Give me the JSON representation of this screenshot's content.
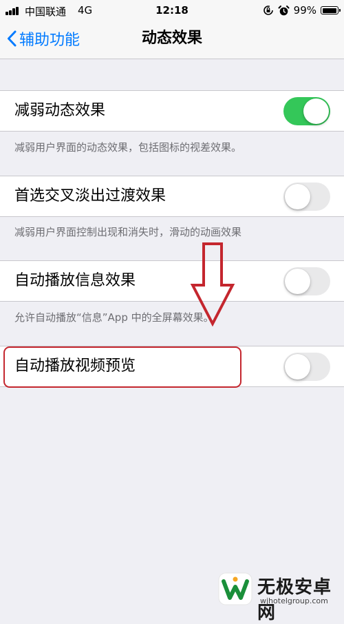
{
  "status_bar": {
    "carrier": "中国联通",
    "network": "4G",
    "time": "12:18",
    "battery_percent": "99%",
    "battery_level": 0.99,
    "icons": [
      "signal-icon",
      "orientation-lock-icon",
      "alarm-icon",
      "battery-icon"
    ]
  },
  "nav": {
    "back_label": "辅助功能",
    "title": "动态效果"
  },
  "settings": [
    {
      "label": "减弱动态效果",
      "toggle_on": true,
      "footer": "减弱用户界面的动态效果，包括图标的视差效果。"
    },
    {
      "label": "首选交叉淡出过渡效果",
      "toggle_on": false,
      "footer": "减弱用户界面控制出现和消失时，滑动的动画效果"
    },
    {
      "label": "自动播放信息效果",
      "toggle_on": false,
      "footer": "允许自动播放“信息”App 中的全屏幕效果。"
    },
    {
      "label": "自动播放视频预览",
      "toggle_on": false
    }
  ],
  "annotation": {
    "color": "#c4262e",
    "highlighted_item": "自动播放视频预览"
  },
  "colors": {
    "background": "#efeff4",
    "accent": "#007aff",
    "toggle_on": "#34c759",
    "toggle_off": "#e9e9ea"
  },
  "watermark": {
    "name": "无极安卓网",
    "url": "wjhotelgroup.com"
  }
}
